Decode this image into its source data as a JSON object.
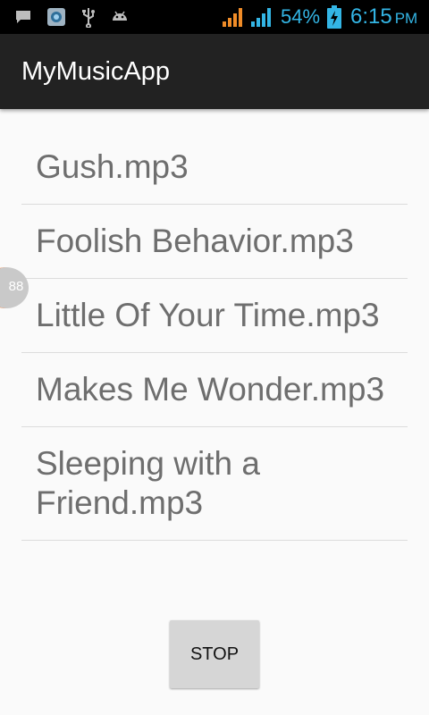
{
  "status_bar": {
    "battery_percent": "54%",
    "time": "6:15",
    "ampm": "PM",
    "accent_color": "#33b5e5",
    "icons": [
      "message-icon",
      "app-icon",
      "usb-icon",
      "android-icon",
      "signal-icon",
      "signal-icon",
      "battery-charging-icon"
    ]
  },
  "app": {
    "title": "MyMusicApp"
  },
  "songs": [
    "Gush.mp3",
    "Foolish Behavior.mp3",
    "Little Of Your Time.mp3",
    "Makes Me Wonder.mp3",
    "Sleeping with a Friend.mp3"
  ],
  "side_bubble": {
    "label": "88"
  },
  "controls": {
    "stop_label": "STOP"
  }
}
